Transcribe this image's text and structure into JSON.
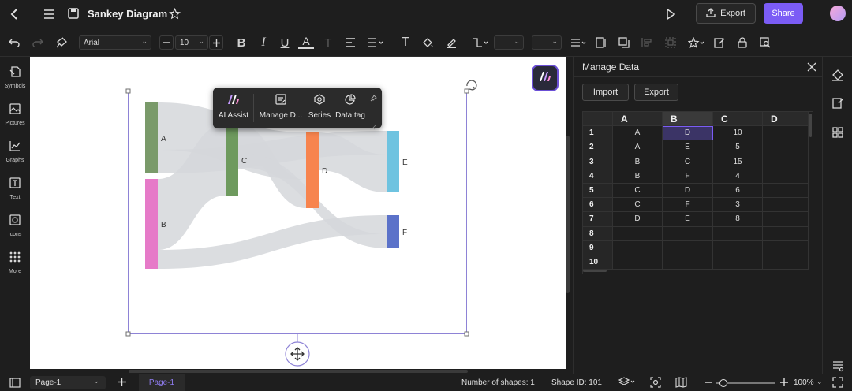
{
  "header": {
    "title": "Sankey Diagram",
    "export_label": "Export",
    "share_label": "Share"
  },
  "toolbar": {
    "font_family": "Arial",
    "font_size": "10"
  },
  "left_rail": [
    {
      "label": "Symbols",
      "icon": "symbols-icon"
    },
    {
      "label": "Pictures",
      "icon": "pictures-icon"
    },
    {
      "label": "Graphs",
      "icon": "graphs-icon"
    },
    {
      "label": "Text",
      "icon": "text-icon"
    },
    {
      "label": "Icons",
      "icon": "icons-icon"
    },
    {
      "label": "More",
      "icon": "more-icon"
    }
  ],
  "float_menu": {
    "ai_assist": "AI Assist",
    "manage_data": "Manage D...",
    "series": "Series",
    "data_tag": "Data tag"
  },
  "chart_data": {
    "type": "sankey",
    "nodes": [
      {
        "name": "A",
        "color": "#7a9a6a"
      },
      {
        "name": "B",
        "color": "#e67ac8"
      },
      {
        "name": "C",
        "color": "#6e9a5e"
      },
      {
        "name": "D",
        "color": "#f7844e"
      },
      {
        "name": "E",
        "color": "#6ec3e0"
      },
      {
        "name": "F",
        "color": "#5b72c9"
      }
    ],
    "links": [
      {
        "source": "A",
        "target": "D",
        "value": 10
      },
      {
        "source": "A",
        "target": "E",
        "value": 5
      },
      {
        "source": "B",
        "target": "C",
        "value": 15
      },
      {
        "source": "B",
        "target": "F",
        "value": 4
      },
      {
        "source": "C",
        "target": "D",
        "value": 6
      },
      {
        "source": "C",
        "target": "F",
        "value": 3
      },
      {
        "source": "D",
        "target": "E",
        "value": 8
      }
    ]
  },
  "manage_data": {
    "title": "Manage Data",
    "import_label": "Import",
    "export_label": "Export",
    "columns": [
      "A",
      "B",
      "C",
      "D"
    ],
    "row_numbers": [
      "1",
      "2",
      "3",
      "4",
      "5",
      "6",
      "7",
      "8",
      "9",
      "10"
    ],
    "rows": [
      [
        "A",
        "D",
        "10",
        ""
      ],
      [
        "A",
        "E",
        "5",
        ""
      ],
      [
        "B",
        "C",
        "15",
        ""
      ],
      [
        "B",
        "F",
        "4",
        ""
      ],
      [
        "C",
        "D",
        "6",
        ""
      ],
      [
        "C",
        "F",
        "3",
        ""
      ],
      [
        "D",
        "E",
        "8",
        ""
      ],
      [
        "",
        "",
        "",
        ""
      ],
      [
        "",
        "",
        "",
        ""
      ],
      [
        "",
        "",
        "",
        ""
      ]
    ],
    "selected_cell": "B1"
  },
  "status": {
    "page_select": "Page-1",
    "page_tab": "Page-1",
    "shape_count": "Number of shapes: 1",
    "shape_id": "Shape ID: 101",
    "zoom": "100%"
  },
  "colors": {
    "accent": "#7b5cf5",
    "link": "#d5d7da",
    "selection": "#8e83d6"
  }
}
